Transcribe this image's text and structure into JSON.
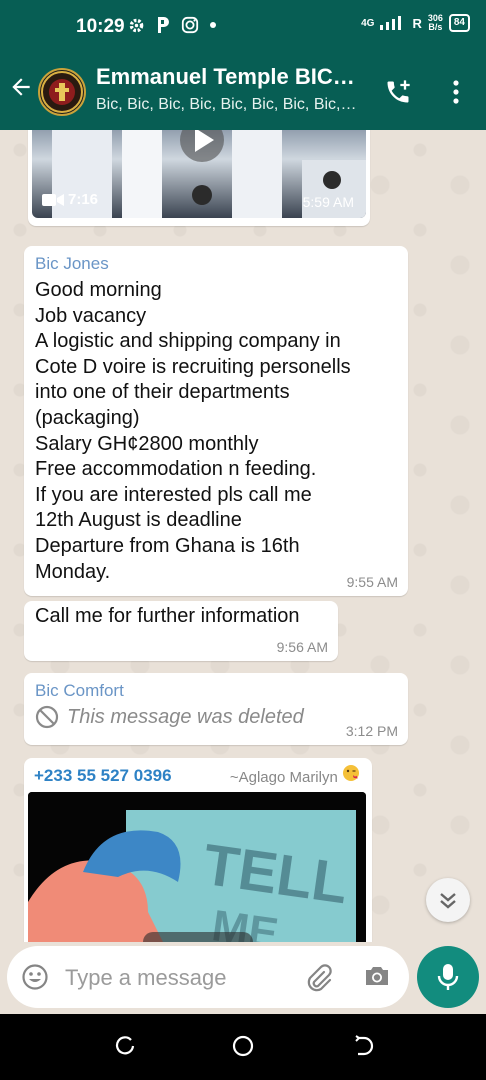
{
  "status": {
    "time": "10:29",
    "network": "4G",
    "roaming": "R",
    "speed_value": "306",
    "speed_unit": "B/s",
    "battery": "84"
  },
  "header": {
    "title": "Emmanuel Temple BIC…",
    "subtitle": "Bic, Bic, Bic, Bic, Bic, Bic, Bic, Bic,…"
  },
  "messages": {
    "video": {
      "duration": "7:16",
      "time": "5:59 AM"
    },
    "job": {
      "sender": "Bic Jones",
      "lines": [
        "Good morning",
        "Job vacancy",
        "A logistic and shipping company in",
        "Cote D voire is recruiting personells",
        "into one of their departments",
        "(packaging)",
        "Salary GH¢2800 monthly",
        "Free accommodation n feeding.",
        "If you are interested pls call me",
        "12th August is deadline",
        "Departure from Ghana is 16th",
        "Monday."
      ],
      "time": "9:55 AM"
    },
    "followup": {
      "text": "Call me for further information",
      "time": "9:56 AM"
    },
    "deleted": {
      "sender": "Bic Comfort",
      "text": "This message was deleted",
      "time": "3:12 PM"
    },
    "image": {
      "phone": "+233 55 527 0396",
      "alias": "~Aglago Marilyn"
    }
  },
  "composer": {
    "placeholder": "Type a message"
  },
  "colors": {
    "header": "#075e54",
    "accent": "#128c7e",
    "sender1": "#6a95c6",
    "sender2": "#6a95c6",
    "phone": "#2e82c5"
  }
}
